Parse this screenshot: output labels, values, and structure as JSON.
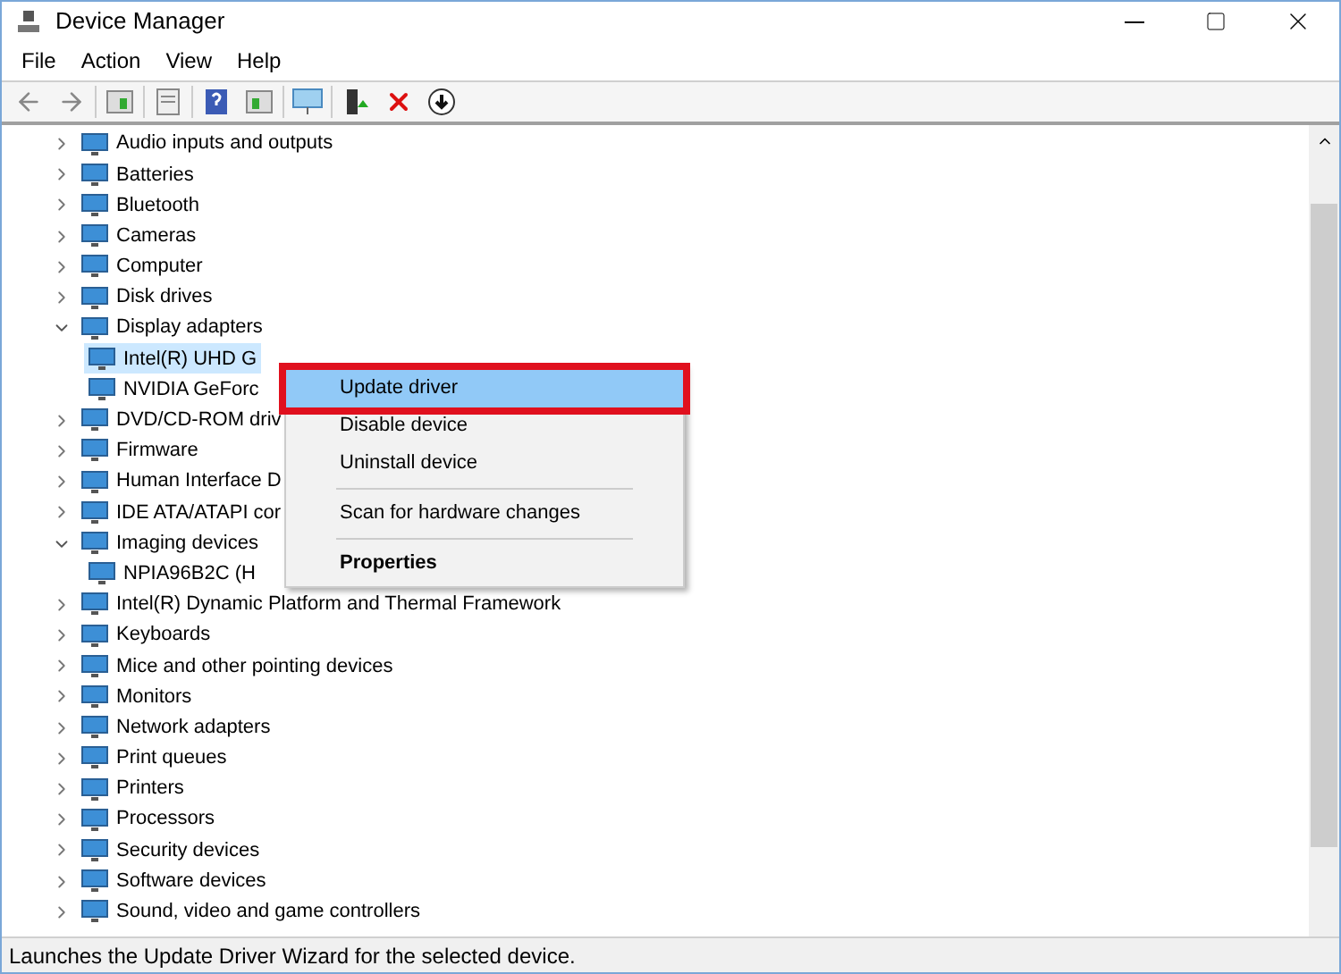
{
  "window": {
    "title": "Device Manager"
  },
  "menu_bar": [
    "File",
    "Action",
    "View",
    "Help"
  ],
  "tree": [
    {
      "label": "Audio inputs and outputs",
      "expanded": false
    },
    {
      "label": "Batteries",
      "expanded": false
    },
    {
      "label": "Bluetooth",
      "expanded": false
    },
    {
      "label": "Cameras",
      "expanded": false
    },
    {
      "label": "Computer",
      "expanded": false
    },
    {
      "label": "Disk drives",
      "expanded": false
    },
    {
      "label": "Display adapters",
      "expanded": true,
      "children": [
        {
          "label": "Intel(R) UHD G",
          "selected": true
        },
        {
          "label": "NVIDIA GeForc",
          "selected": false
        }
      ]
    },
    {
      "label": "DVD/CD-ROM driv",
      "expanded": false
    },
    {
      "label": "Firmware",
      "expanded": false
    },
    {
      "label": "Human Interface D",
      "expanded": false
    },
    {
      "label": "IDE ATA/ATAPI cor",
      "expanded": false
    },
    {
      "label": "Imaging devices",
      "expanded": true,
      "children": [
        {
          "label": "NPIA96B2C (H",
          "selected": false
        }
      ]
    },
    {
      "label": "Intel(R) Dynamic Platform and Thermal Framework",
      "expanded": false
    },
    {
      "label": "Keyboards",
      "expanded": false
    },
    {
      "label": "Mice and other pointing devices",
      "expanded": false
    },
    {
      "label": "Monitors",
      "expanded": false
    },
    {
      "label": "Network adapters",
      "expanded": false
    },
    {
      "label": "Print queues",
      "expanded": false
    },
    {
      "label": "Printers",
      "expanded": false
    },
    {
      "label": "Processors",
      "expanded": false
    },
    {
      "label": "Security devices",
      "expanded": false
    },
    {
      "label": "Software devices",
      "expanded": false
    },
    {
      "label": "Sound, video and game controllers",
      "expanded": false
    }
  ],
  "context_menu": [
    {
      "kind": "item",
      "label": "Update driver",
      "selected": true
    },
    {
      "kind": "item",
      "label": "Disable device",
      "selected": false
    },
    {
      "kind": "item",
      "label": "Uninstall device",
      "selected": false
    },
    {
      "kind": "separator"
    },
    {
      "kind": "item",
      "label": "Scan for hardware changes",
      "selected": false
    },
    {
      "kind": "separator"
    },
    {
      "kind": "default",
      "label": "Properties",
      "selected": false
    }
  ],
  "status_bar": "Launches the Update Driver Wizard for the selected device."
}
